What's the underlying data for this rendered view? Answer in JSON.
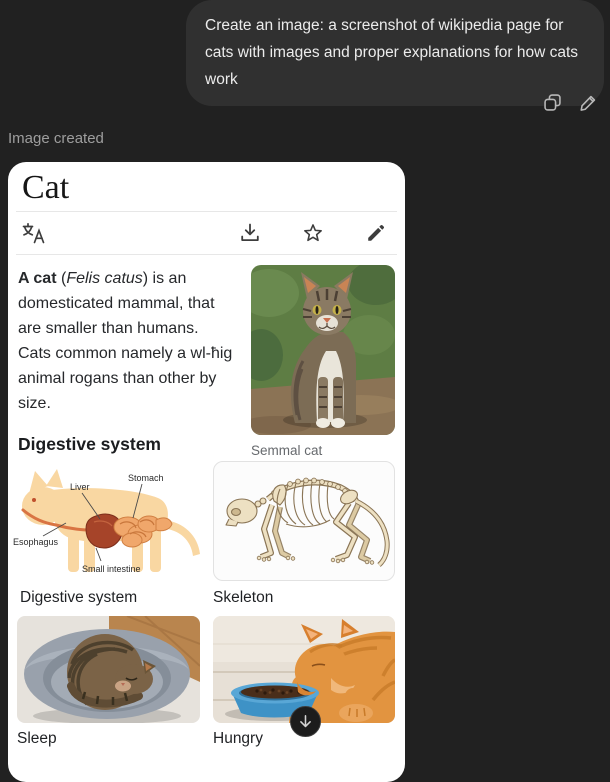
{
  "chat": {
    "user_message": "Create an image: a screenshot of wikipedia page for cats with images and proper explanations for how cats work",
    "status_label": "Image created",
    "message_action_icons": [
      "copy-icon",
      "edit-icon"
    ],
    "scroll_button_icon": "arrow-down-icon"
  },
  "wiki": {
    "title": "Cat",
    "toolbar_icons": [
      "language-icon",
      "download-icon",
      "star-icon",
      "edit-pencil-icon"
    ],
    "intro": {
      "line1_bold": "A cat",
      "line1_pre": " (",
      "line1_italic": "Felis catus",
      "line1_post": ") is an",
      "line2": "domesticated mammal, that",
      "line3": "are smaller than humans.",
      "line4": "Cats common namely a wl-ħig",
      "line5": "animal rogans than other by",
      "line6": "size."
    },
    "lead_image_caption": "Semmal cat",
    "section_heading": "Digestive system",
    "diagram": {
      "label_liver": "Liver",
      "label_stomach": "Stomach",
      "label_esophagus": "Esophagus",
      "label_small_intestine": "Small intestine",
      "caption": "Digestive system"
    },
    "gallery": {
      "skeleton_caption": "Skeleton",
      "sleep_caption": "Sleep",
      "hungry_caption": "Hungry"
    }
  },
  "colors": {
    "background": "#212121",
    "bubble": "#303030",
    "card": "#ffffff",
    "status_text": "#9e9e9e",
    "diagram_body": "#f9d7a2",
    "liver": "#a64429",
    "intestine": "#f0a76b",
    "bowl_blue": "#3e92c6"
  }
}
